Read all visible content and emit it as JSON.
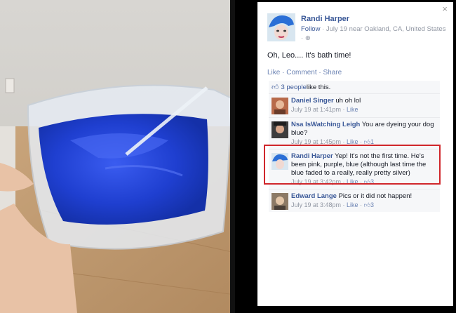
{
  "post": {
    "author": "Randi Harper",
    "follow_label": "Follow",
    "meta_text": "· July 19 near Oakland, CA, United States ·",
    "status": "Oh, Leo.... It's bath time!",
    "actions": [
      "Like",
      "Comment",
      "Share"
    ],
    "likes_count_text": "3 people",
    "likes_suffix": " like this."
  },
  "comments": [
    {
      "name": "Daniel Singer",
      "text": " uh oh lol",
      "time": "July 19 at 1:41pm",
      "like": "Like",
      "likes": ""
    },
    {
      "name": "Nsa IsWatching Leigh",
      "text": " You are dyeing your dog blue?",
      "time": "July 19 at 1:45pm",
      "like": "Like",
      "likes": "1"
    },
    {
      "name": "Randi Harper",
      "text": " Yep! It's not the first time. He's been pink, purple, blue (although last time the blue faded to a really, really pretty silver)",
      "time": "July 19 at 3:42pm",
      "like": "Like",
      "likes": "3"
    },
    {
      "name": "Edward Lange",
      "text": " Pics or it did not happen!",
      "time": "July 19 at 3:48pm",
      "like": "Like",
      "likes": "3"
    }
  ],
  "close_symbol": "×",
  "dot": " · ",
  "colors": {
    "link": "#3b5998",
    "meta": "#9197a3",
    "highlight": "#d0262b",
    "dye": "#1f3fd0"
  }
}
